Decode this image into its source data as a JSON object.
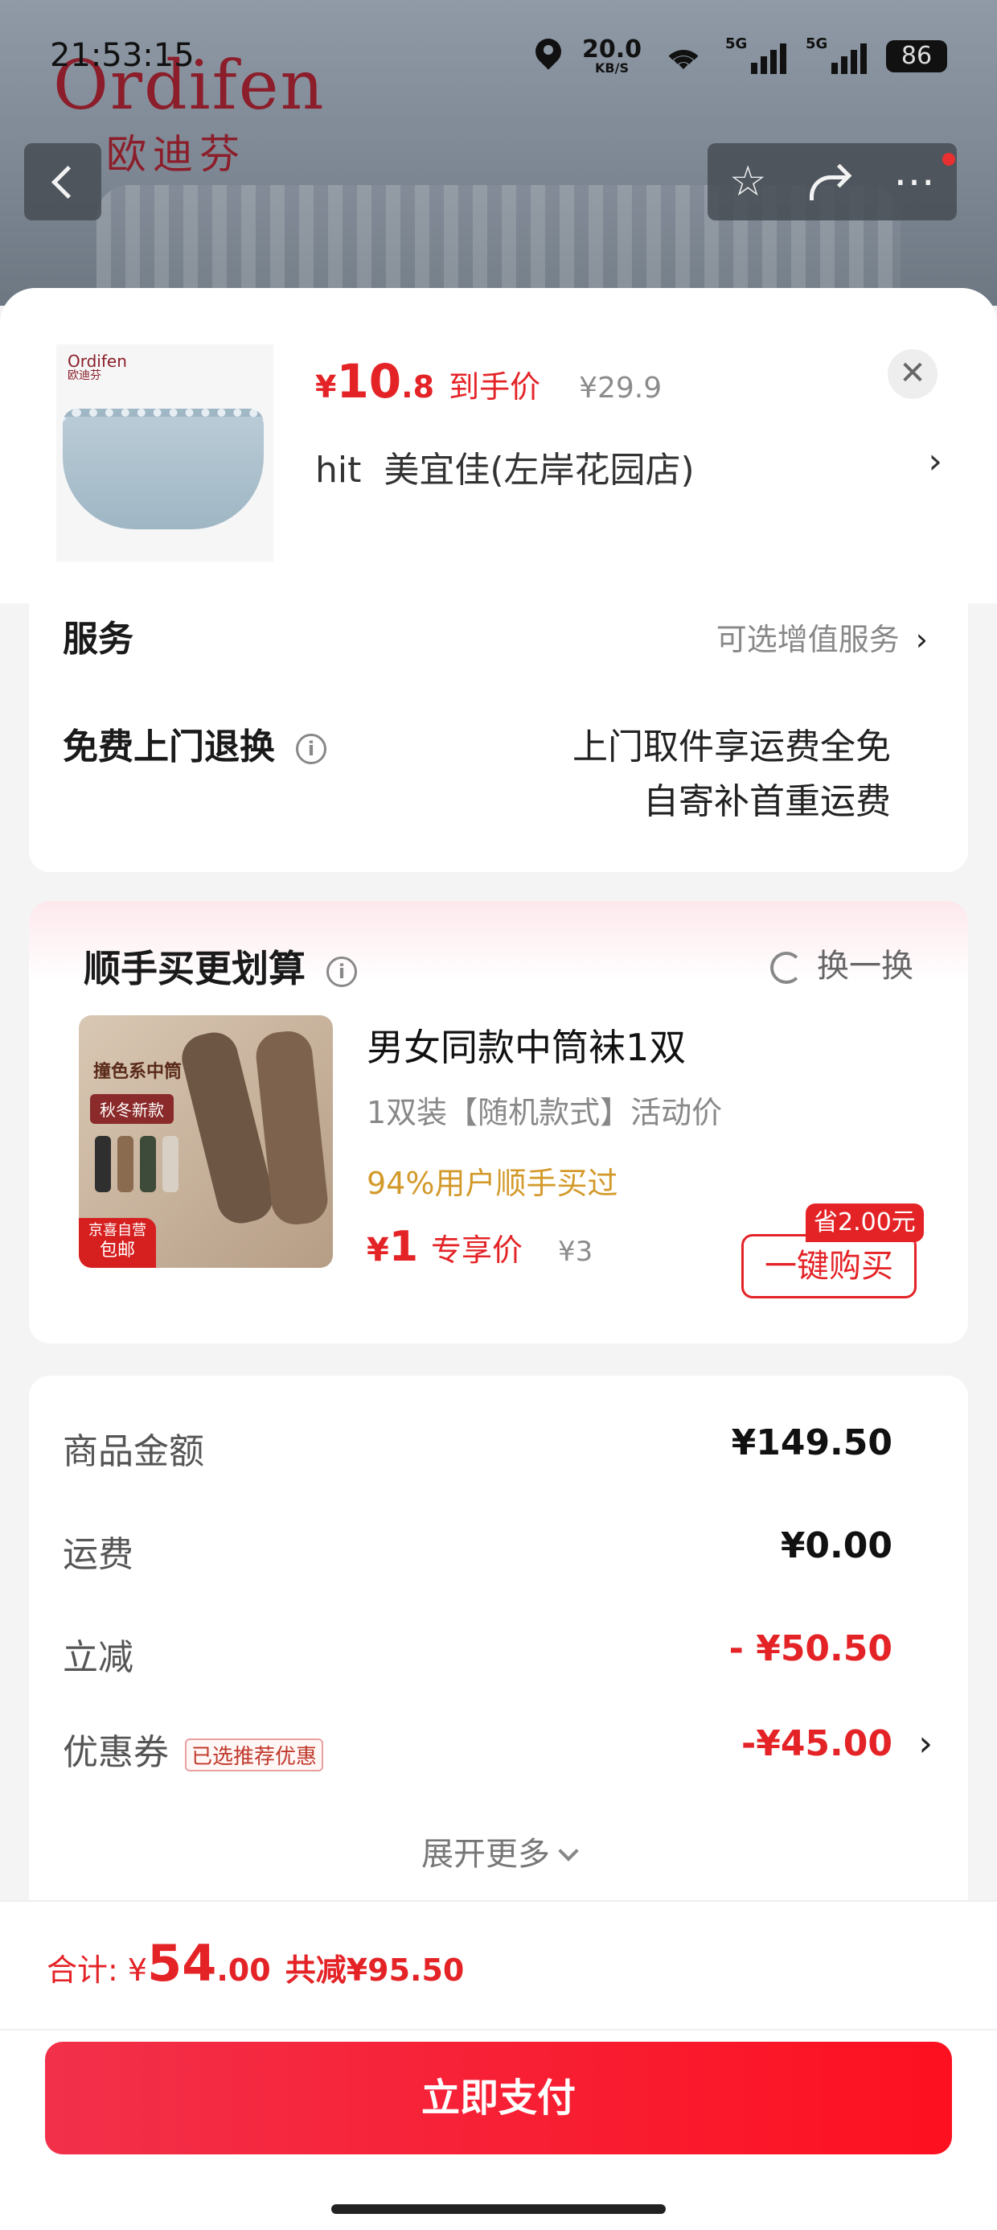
{
  "status_bar": {
    "time": "21:53:15",
    "speed": "20.0",
    "speed_unit": "KB/S",
    "sim1": "5G",
    "sim2": "5G",
    "battery": "86"
  },
  "brand": {
    "en": "Ordifen",
    "cn": "欧迪芬"
  },
  "nav": {
    "back_icon": "chevron-left-icon",
    "favorite_icon": "star-icon",
    "share_icon": "share-icon",
    "more_icon": "more-icon"
  },
  "product": {
    "thumb_brand_en": "Ordifen",
    "thumb_brand_cn": "欧迪芬",
    "currency": "¥",
    "price_int": "10",
    "price_dec": ".8",
    "price_label": "到手价",
    "original_price": "¥29.9",
    "store_prefix": "hit",
    "store_name": "美宜佳(左岸花园店)",
    "close_icon": "close-icon"
  },
  "service": {
    "title": "服务",
    "optional": "可选增值服务",
    "return_title": "免费上门退换",
    "return_line1": "上门取件享运费全免",
    "return_line2": "自寄补首重运费"
  },
  "combo": {
    "title": "顺手买更划算",
    "swap": "换一换",
    "image_tag": "撞色系中筒",
    "image_tag2": "秋冬新款",
    "image_badge_line1": "京喜自营",
    "image_badge_line2": "包邮",
    "name": "男女同款中筒袜1双",
    "desc": "1双装【随机款式】活动价",
    "popularity": "94%用户顺手买过",
    "currency": "¥",
    "price": "1",
    "price_label": "专享价",
    "original_price": "¥3",
    "save_badge": "省2.00元",
    "buy_button": "一键购买"
  },
  "summary": {
    "rows": [
      {
        "label": "商品金额",
        "value": "¥149.50"
      },
      {
        "label": "运费",
        "value": "¥0.00"
      },
      {
        "label": "立减",
        "value": "- ¥50.50"
      },
      {
        "label": "优惠券",
        "tag": "已选推荐优惠",
        "value": "-¥45.00"
      }
    ],
    "expand": "展开更多"
  },
  "footer": {
    "total_label": "合计:",
    "currency": "¥",
    "total_int": "54",
    "total_dec": ".00",
    "total_reduced": "共减¥95.50",
    "pay_button": "立即支付"
  },
  "colors": {
    "accent": "#e42327",
    "popularity": "#d39a2b"
  }
}
